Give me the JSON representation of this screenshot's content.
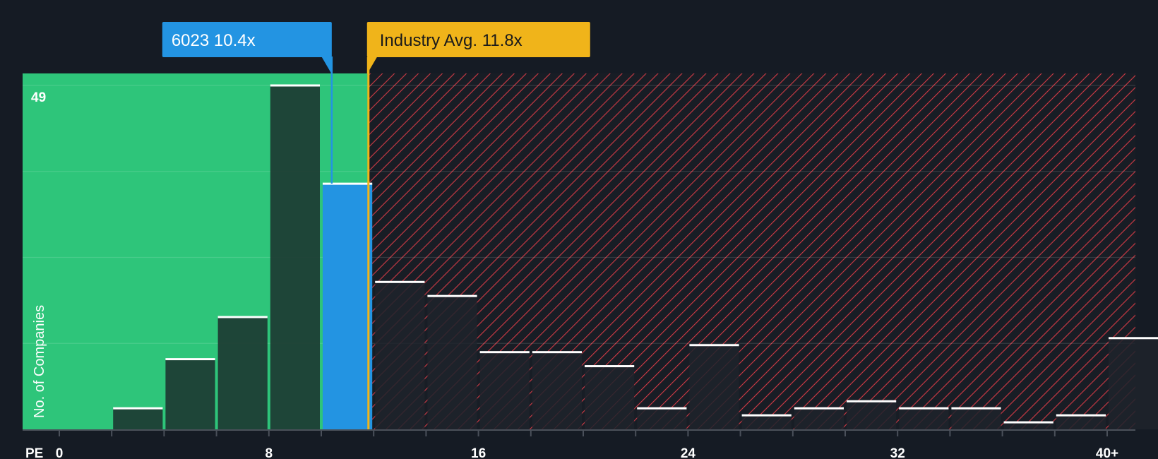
{
  "chart_data": {
    "type": "bar",
    "xlabel": "PE",
    "ylabel": "No. of Companies",
    "x_tick_labels": [
      "0",
      "8",
      "16",
      "24",
      "32",
      "40+"
    ],
    "x_ticks": [
      0,
      8,
      16,
      24,
      32,
      40
    ],
    "y_max_label": "49",
    "ylim": [
      0,
      49
    ],
    "xlim": [
      0,
      41
    ],
    "bin_width": 2,
    "bins": [
      {
        "start": 2,
        "value": 3
      },
      {
        "start": 4,
        "value": 10
      },
      {
        "start": 6,
        "value": 16
      },
      {
        "start": 8,
        "value": 49
      },
      {
        "start": 10,
        "value": 35,
        "highlight": true
      },
      {
        "start": 12,
        "value": 21
      },
      {
        "start": 14,
        "value": 19
      },
      {
        "start": 16,
        "value": 11
      },
      {
        "start": 18,
        "value": 11
      },
      {
        "start": 20,
        "value": 9
      },
      {
        "start": 22,
        "value": 3
      },
      {
        "start": 24,
        "value": 12
      },
      {
        "start": 26,
        "value": 2
      },
      {
        "start": 28,
        "value": 3
      },
      {
        "start": 30,
        "value": 4
      },
      {
        "start": 32,
        "value": 3
      },
      {
        "start": 34,
        "value": 3
      },
      {
        "start": 36,
        "value": 1
      },
      {
        "start": 38,
        "value": 2
      },
      {
        "start": 40,
        "value": 13
      }
    ],
    "company": {
      "label": "6023 10.4x",
      "value": 10.4
    },
    "industry_avg": {
      "label": "Industry Avg. 11.8x",
      "value": 11.8
    },
    "colors": {
      "background": "#151b24",
      "below_zone": "#2ec57a",
      "above_zone_hatch": "#d23a45",
      "company": "#2394e2",
      "industry": "#f0b41a",
      "bar_fill": "#1d3a32",
      "bar_fill_above": "#1f232b",
      "bar_cap": "#ffffff",
      "text": "#ffffff"
    }
  }
}
